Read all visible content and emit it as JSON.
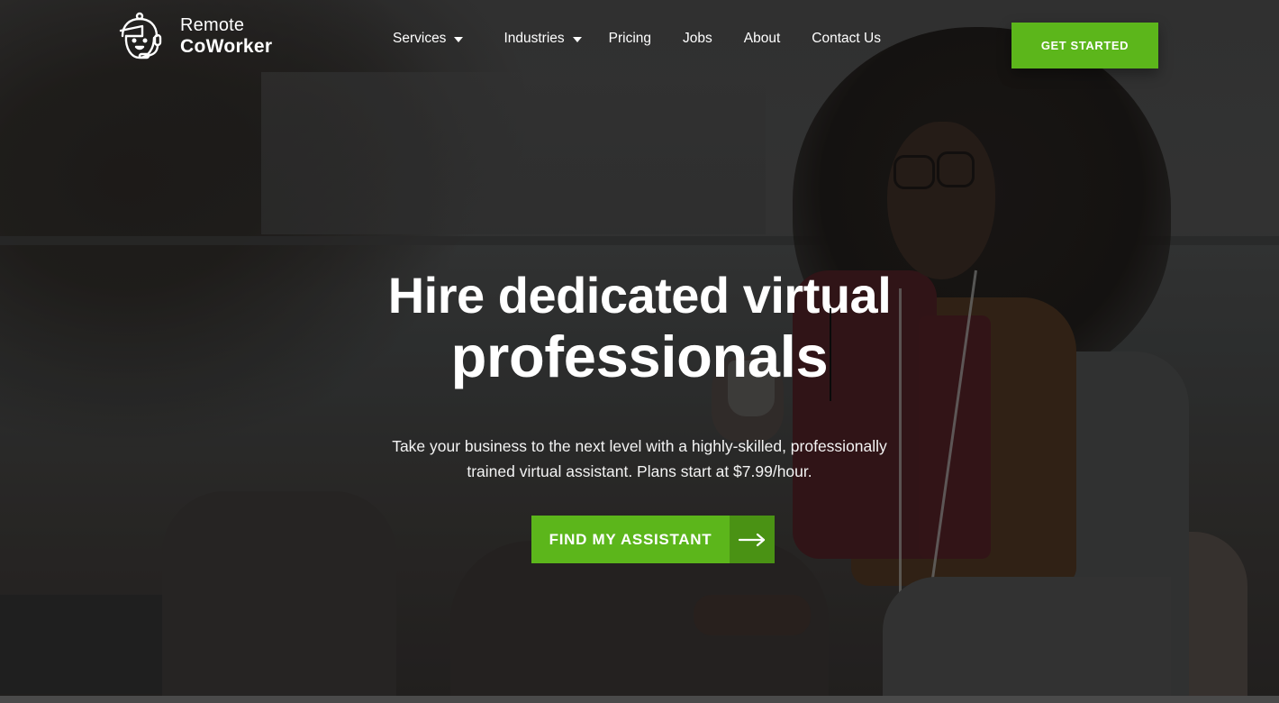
{
  "brand": {
    "name_line1": "Remote",
    "name_line2": "CoWorker",
    "logo_icon": "headset-avatar-icon"
  },
  "nav": {
    "items": [
      {
        "label": "Services",
        "has_dropdown": true
      },
      {
        "label": "Industries",
        "has_dropdown": true
      },
      {
        "label": "Pricing",
        "has_dropdown": false
      },
      {
        "label": "Jobs",
        "has_dropdown": false
      },
      {
        "label": "About",
        "has_dropdown": false
      },
      {
        "label": "Contact Us",
        "has_dropdown": false
      }
    ],
    "cta_label": "GET STARTED"
  },
  "hero": {
    "headline_line1": "Hire dedicated virtual",
    "headline_line2": "professionals",
    "subtext_line1": "Take your business to the next level with a highly-skilled, professionally",
    "subtext_line2": "trained virtual assistant. Plans start at $7.99/hour.",
    "cta_label": "FIND MY ASSISTANT",
    "cta_icon": "arrow-right-icon"
  },
  "colors": {
    "accent": "#5cb61b",
    "accent_dark": "#4a9214",
    "text": "#ffffff"
  }
}
